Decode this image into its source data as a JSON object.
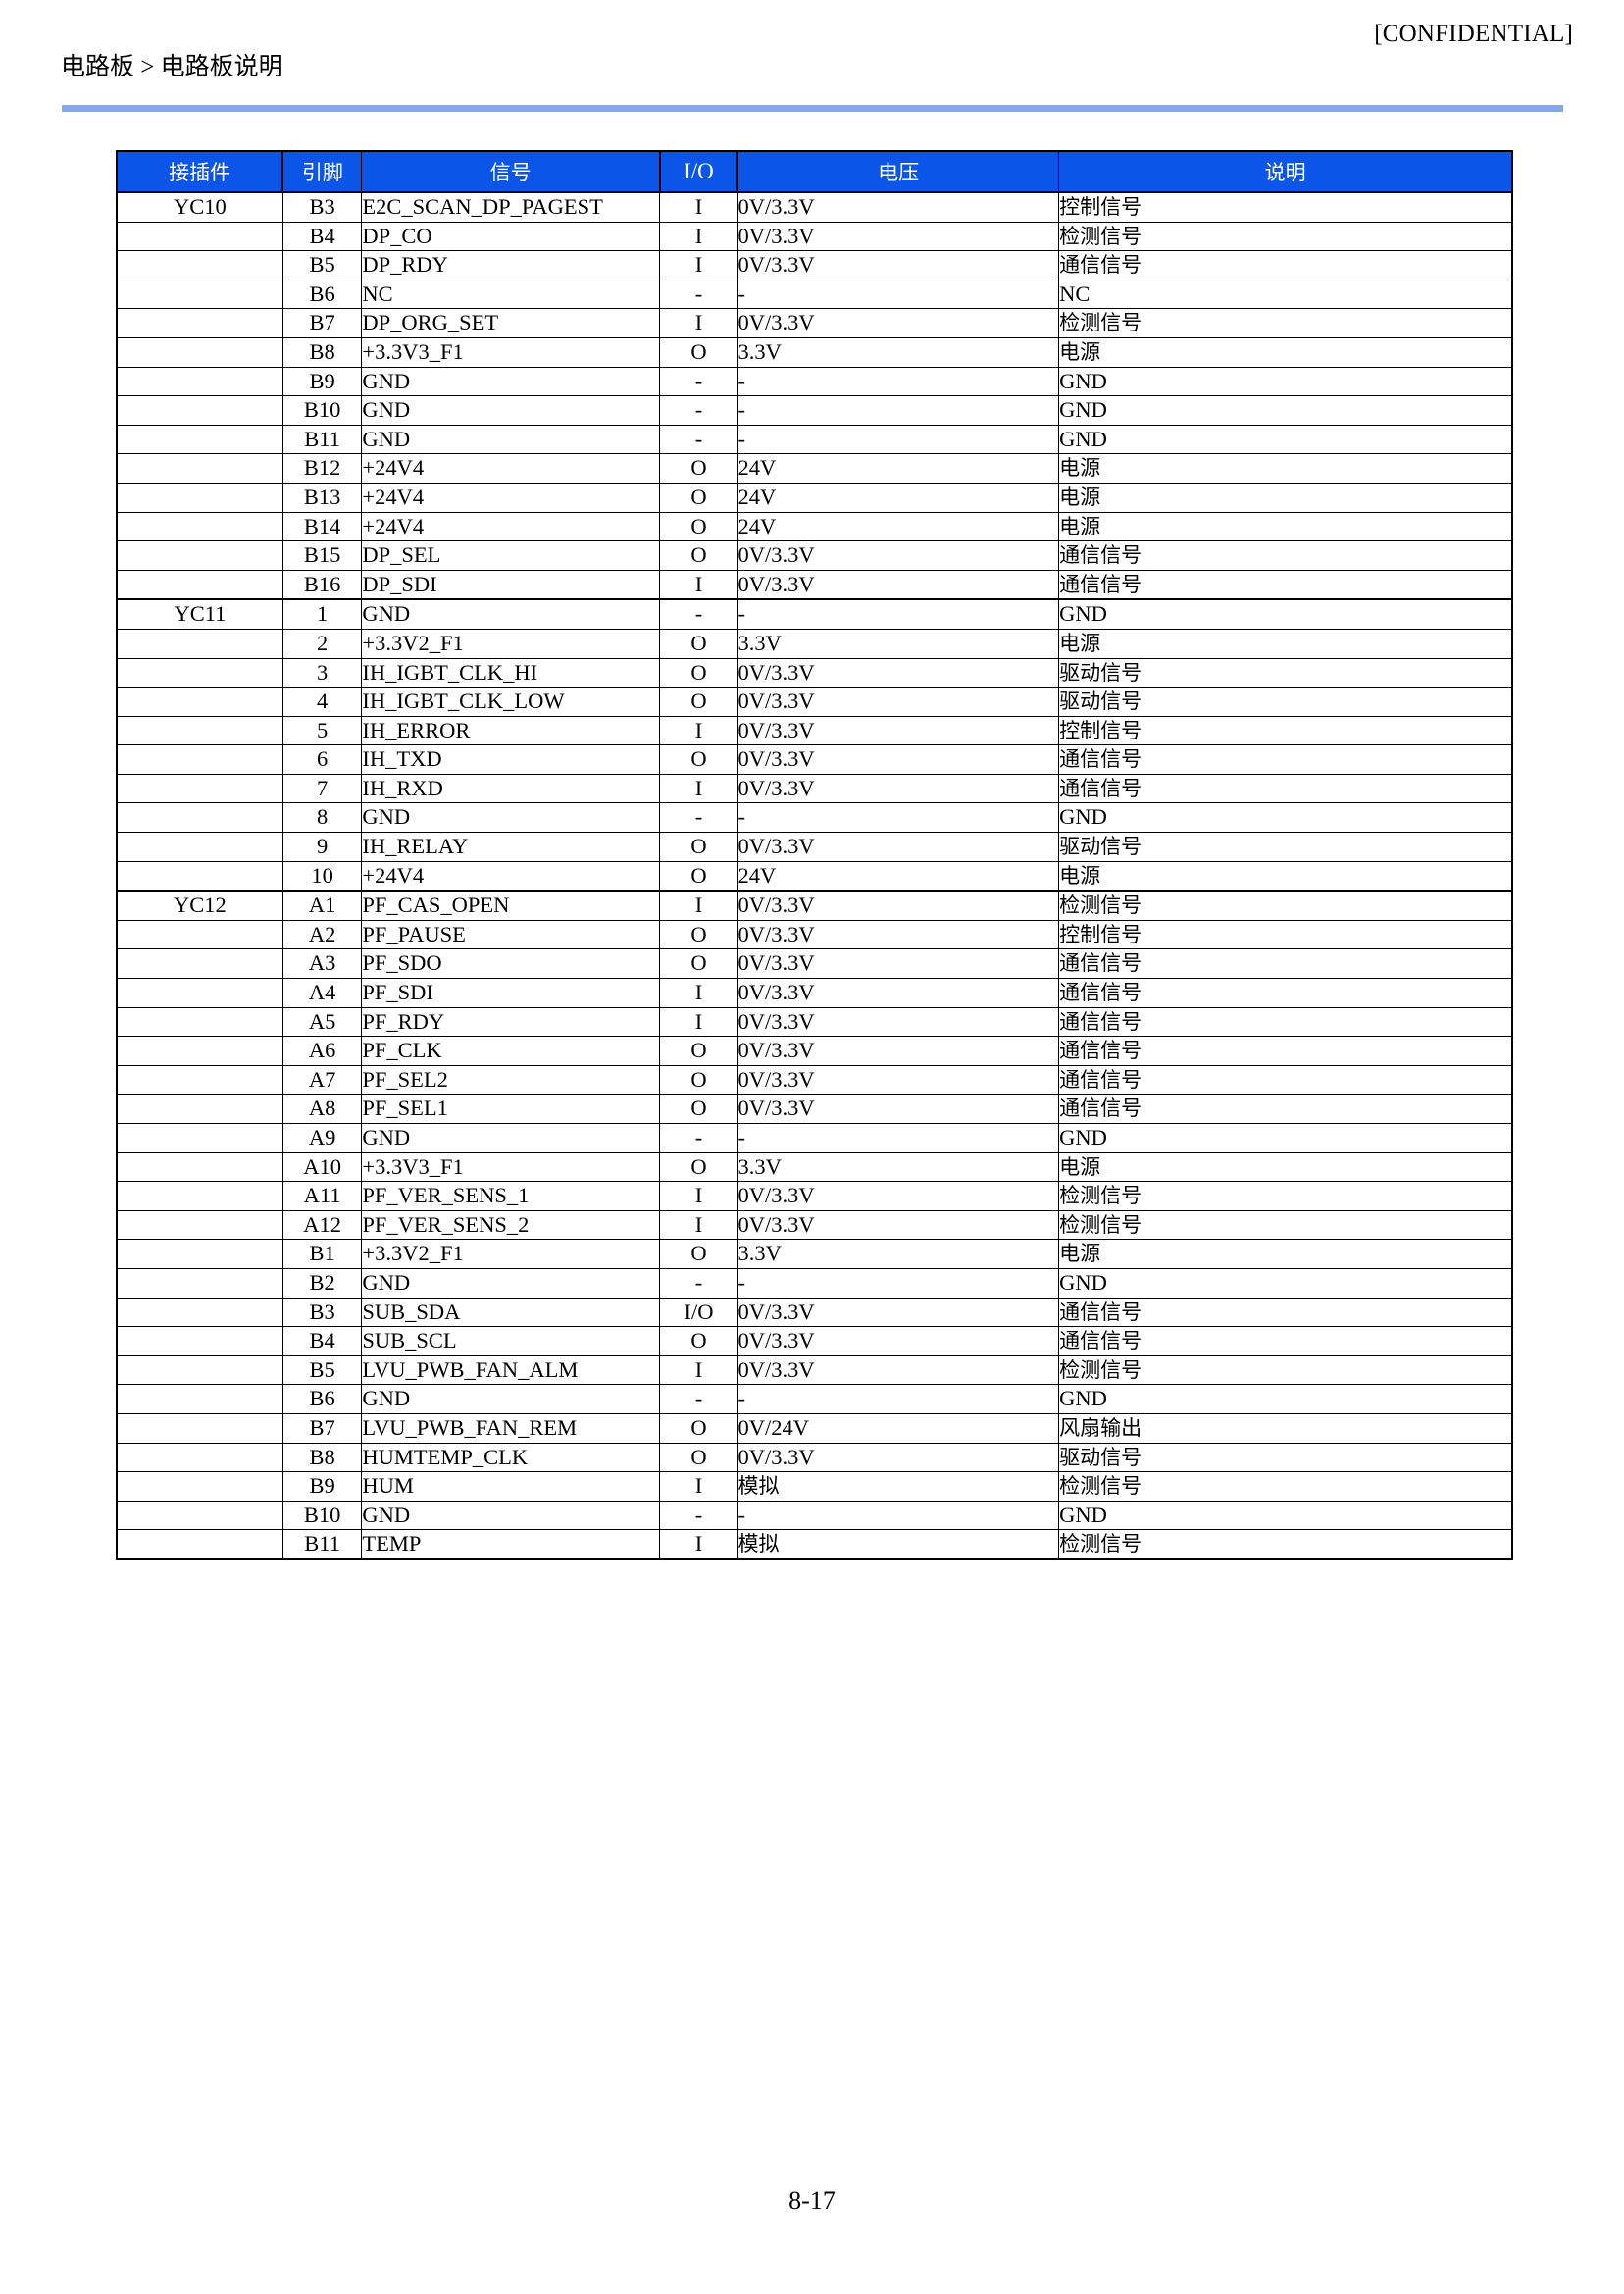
{
  "header": {
    "confidential": "[CONFIDENTIAL]",
    "breadcrumb": "电路板 > 电路板说明",
    "rule_color": "#82a8ee"
  },
  "footer": {
    "page_number": "8-17"
  },
  "table": {
    "header_bg": "#0b55e8",
    "header_fg": "#ffffff",
    "columns": [
      {
        "key": "connector",
        "label": "接插件"
      },
      {
        "key": "pin",
        "label": "引脚"
      },
      {
        "key": "signal",
        "label": "信号"
      },
      {
        "key": "io",
        "label": "I/O"
      },
      {
        "key": "voltage",
        "label": "电压"
      },
      {
        "key": "description",
        "label": "说明"
      }
    ],
    "groups": [
      {
        "connector": "YC10",
        "rows": [
          {
            "pin": "B3",
            "signal": "E2C_SCAN_DP_PAGEST",
            "io": "I",
            "voltage": "0V/3.3V",
            "description": "控制信号"
          },
          {
            "pin": "B4",
            "signal": "DP_CO",
            "io": "I",
            "voltage": "0V/3.3V",
            "description": "检测信号"
          },
          {
            "pin": "B5",
            "signal": "DP_RDY",
            "io": "I",
            "voltage": "0V/3.3V",
            "description": "通信信号"
          },
          {
            "pin": "B6",
            "signal": "NC",
            "io": "-",
            "voltage": "-",
            "description": "NC"
          },
          {
            "pin": "B7",
            "signal": "DP_ORG_SET",
            "io": "I",
            "voltage": "0V/3.3V",
            "description": "检测信号"
          },
          {
            "pin": "B8",
            "signal": "+3.3V3_F1",
            "io": "O",
            "voltage": "3.3V",
            "description": "电源"
          },
          {
            "pin": "B9",
            "signal": "GND",
            "io": "-",
            "voltage": "-",
            "description": "GND"
          },
          {
            "pin": "B10",
            "signal": "GND",
            "io": "-",
            "voltage": "-",
            "description": "GND"
          },
          {
            "pin": "B11",
            "signal": "GND",
            "io": "-",
            "voltage": "-",
            "description": "GND"
          },
          {
            "pin": "B12",
            "signal": "+24V4",
            "io": "O",
            "voltage": "24V",
            "description": "电源"
          },
          {
            "pin": "B13",
            "signal": "+24V4",
            "io": "O",
            "voltage": "24V",
            "description": "电源"
          },
          {
            "pin": "B14",
            "signal": "+24V4",
            "io": "O",
            "voltage": "24V",
            "description": "电源"
          },
          {
            "pin": "B15",
            "signal": "DP_SEL",
            "io": "O",
            "voltage": "0V/3.3V",
            "description": "通信信号"
          },
          {
            "pin": "B16",
            "signal": "DP_SDI",
            "io": "I",
            "voltage": "0V/3.3V",
            "description": "通信信号"
          }
        ]
      },
      {
        "connector": "YC11",
        "rows": [
          {
            "pin": "1",
            "signal": "GND",
            "io": "-",
            "voltage": "-",
            "description": "GND"
          },
          {
            "pin": "2",
            "signal": "+3.3V2_F1",
            "io": "O",
            "voltage": "3.3V",
            "description": "电源"
          },
          {
            "pin": "3",
            "signal": "IH_IGBT_CLK_HI",
            "io": "O",
            "voltage": "0V/3.3V",
            "description": "驱动信号"
          },
          {
            "pin": "4",
            "signal": "IH_IGBT_CLK_LOW",
            "io": "O",
            "voltage": "0V/3.3V",
            "description": "驱动信号"
          },
          {
            "pin": "5",
            "signal": "IH_ERROR",
            "io": "I",
            "voltage": "0V/3.3V",
            "description": "控制信号"
          },
          {
            "pin": "6",
            "signal": "IH_TXD",
            "io": "O",
            "voltage": "0V/3.3V",
            "description": "通信信号"
          },
          {
            "pin": "7",
            "signal": "IH_RXD",
            "io": "I",
            "voltage": "0V/3.3V",
            "description": "通信信号"
          },
          {
            "pin": "8",
            "signal": "GND",
            "io": "-",
            "voltage": "-",
            "description": "GND"
          },
          {
            "pin": "9",
            "signal": "IH_RELAY",
            "io": "O",
            "voltage": "0V/3.3V",
            "description": "驱动信号"
          },
          {
            "pin": "10",
            "signal": "+24V4",
            "io": "O",
            "voltage": "24V",
            "description": "电源"
          }
        ]
      },
      {
        "connector": "YC12",
        "rows": [
          {
            "pin": "A1",
            "signal": "PF_CAS_OPEN",
            "io": "I",
            "voltage": "0V/3.3V",
            "description": "检测信号"
          },
          {
            "pin": "A2",
            "signal": "PF_PAUSE",
            "io": "O",
            "voltage": "0V/3.3V",
            "description": "控制信号"
          },
          {
            "pin": "A3",
            "signal": "PF_SDO",
            "io": "O",
            "voltage": "0V/3.3V",
            "description": "通信信号"
          },
          {
            "pin": "A4",
            "signal": "PF_SDI",
            "io": "I",
            "voltage": "0V/3.3V",
            "description": "通信信号"
          },
          {
            "pin": "A5",
            "signal": "PF_RDY",
            "io": "I",
            "voltage": "0V/3.3V",
            "description": "通信信号"
          },
          {
            "pin": "A6",
            "signal": "PF_CLK",
            "io": "O",
            "voltage": "0V/3.3V",
            "description": "通信信号"
          },
          {
            "pin": "A7",
            "signal": "PF_SEL2",
            "io": "O",
            "voltage": "0V/3.3V",
            "description": "通信信号"
          },
          {
            "pin": "A8",
            "signal": "PF_SEL1",
            "io": "O",
            "voltage": "0V/3.3V",
            "description": "通信信号"
          },
          {
            "pin": "A9",
            "signal": "GND",
            "io": "-",
            "voltage": "-",
            "description": "GND"
          },
          {
            "pin": "A10",
            "signal": "+3.3V3_F1",
            "io": "O",
            "voltage": "3.3V",
            "description": "电源"
          },
          {
            "pin": "A11",
            "signal": "PF_VER_SENS_1",
            "io": "I",
            "voltage": "0V/3.3V",
            "description": "检测信号"
          },
          {
            "pin": "A12",
            "signal": "PF_VER_SENS_2",
            "io": "I",
            "voltage": "0V/3.3V",
            "description": "检测信号"
          },
          {
            "pin": "B1",
            "signal": "+3.3V2_F1",
            "io": "O",
            "voltage": "3.3V",
            "description": "电源"
          },
          {
            "pin": "B2",
            "signal": "GND",
            "io": "-",
            "voltage": "-",
            "description": "GND"
          },
          {
            "pin": "B3",
            "signal": "SUB_SDA",
            "io": "I/O",
            "voltage": "0V/3.3V",
            "description": "通信信号"
          },
          {
            "pin": "B4",
            "signal": "SUB_SCL",
            "io": "O",
            "voltage": "0V/3.3V",
            "description": "通信信号"
          },
          {
            "pin": "B5",
            "signal": "LVU_PWB_FAN_ALM",
            "io": "I",
            "voltage": "0V/3.3V",
            "description": "检测信号"
          },
          {
            "pin": "B6",
            "signal": "GND",
            "io": "-",
            "voltage": "-",
            "description": "GND"
          },
          {
            "pin": "B7",
            "signal": "LVU_PWB_FAN_REM",
            "io": "O",
            "voltage": "0V/24V",
            "description": "风扇输出"
          },
          {
            "pin": "B8",
            "signal": "HUMTEMP_CLK",
            "io": "O",
            "voltage": "0V/3.3V",
            "description": "驱动信号"
          },
          {
            "pin": "B9",
            "signal": "HUM",
            "io": "I",
            "voltage": "模拟",
            "description": "检测信号"
          },
          {
            "pin": "B10",
            "signal": "GND",
            "io": "-",
            "voltage": "-",
            "description": "GND"
          },
          {
            "pin": "B11",
            "signal": "TEMP",
            "io": "I",
            "voltage": "模拟",
            "description": "检测信号"
          }
        ]
      }
    ]
  }
}
